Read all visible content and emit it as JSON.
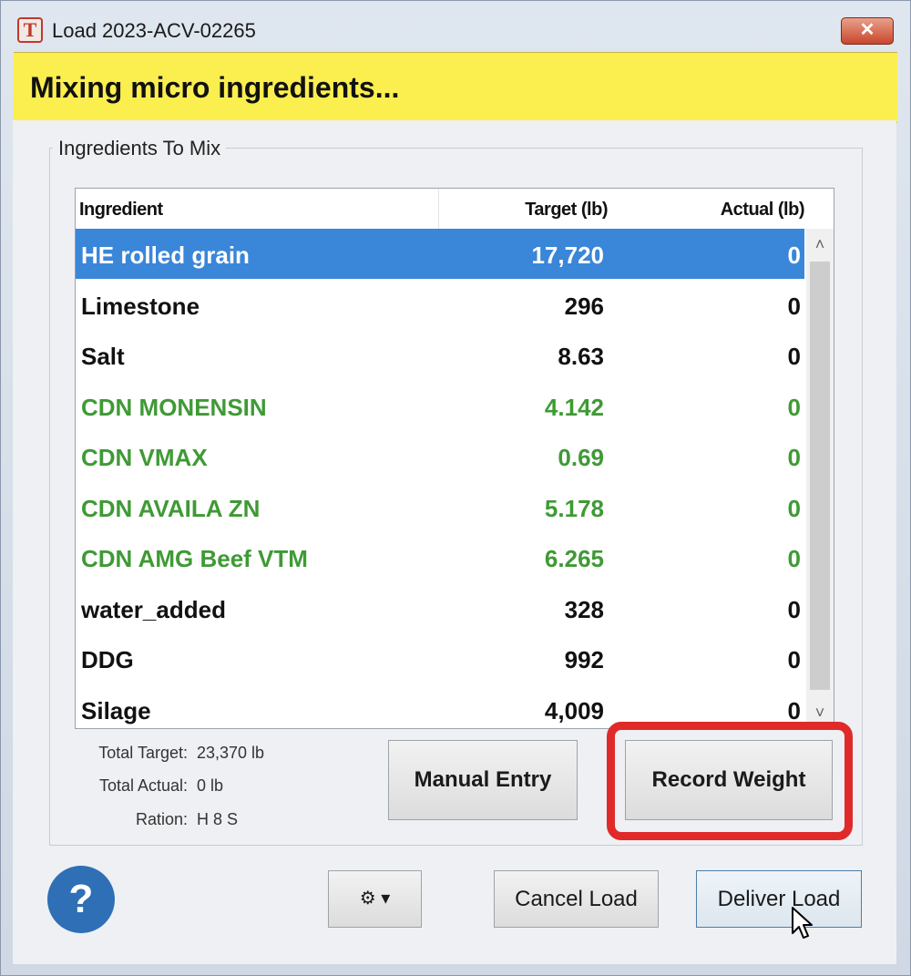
{
  "window": {
    "title": "Load 2023-ACV-02265",
    "close_label": "✕",
    "app_icon_letter": "T"
  },
  "banner": {
    "text": "Mixing micro ingredients..."
  },
  "group": {
    "title": "Ingredients To Mix"
  },
  "grid": {
    "columns": [
      "Ingredient",
      "Target (lb)",
      "Actual (lb)"
    ],
    "rows": [
      {
        "name": "HE rolled grain",
        "target": "17,720",
        "actual": "0",
        "style": "selected"
      },
      {
        "name": "Limestone",
        "target": "296",
        "actual": "0",
        "style": "black"
      },
      {
        "name": "Salt",
        "target": "8.63",
        "actual": "0",
        "style": "black"
      },
      {
        "name": "CDN MONENSIN",
        "target": "4.142",
        "actual": "0",
        "style": "green"
      },
      {
        "name": "CDN VMAX",
        "target": "0.69",
        "actual": "0",
        "style": "green"
      },
      {
        "name": "CDN AVAILA ZN",
        "target": "5.178",
        "actual": "0",
        "style": "green"
      },
      {
        "name": "CDN AMG Beef VTM",
        "target": "6.265",
        "actual": "0",
        "style": "green"
      },
      {
        "name": "water_added",
        "target": "328",
        "actual": "0",
        "style": "black"
      },
      {
        "name": "DDG",
        "target": "992",
        "actual": "0",
        "style": "black"
      },
      {
        "name": "Silage",
        "target": "4,009",
        "actual": "0",
        "style": "black"
      }
    ],
    "scroll_up": "˄",
    "scroll_down": "˅"
  },
  "summary": {
    "total_target_label": "Total Target:",
    "total_target_value": "23,370 lb",
    "total_actual_label": "Total Actual:",
    "total_actual_value": "0 lb",
    "ration_label": "Ration:",
    "ration_value": "H 8 S"
  },
  "buttons": {
    "manual_entry": "Manual Entry",
    "record_weight": "Record Weight",
    "settings": "⚙ ▾",
    "cancel_load": "Cancel Load",
    "deliver_load": "Deliver Load",
    "help": "?"
  },
  "colors": {
    "banner": "#fbee4f",
    "selection": "#3a86d8",
    "micro_ingredient_text": "#3f9a35",
    "highlight_box": "#e02a2a",
    "help_button": "#2f6fb6"
  }
}
